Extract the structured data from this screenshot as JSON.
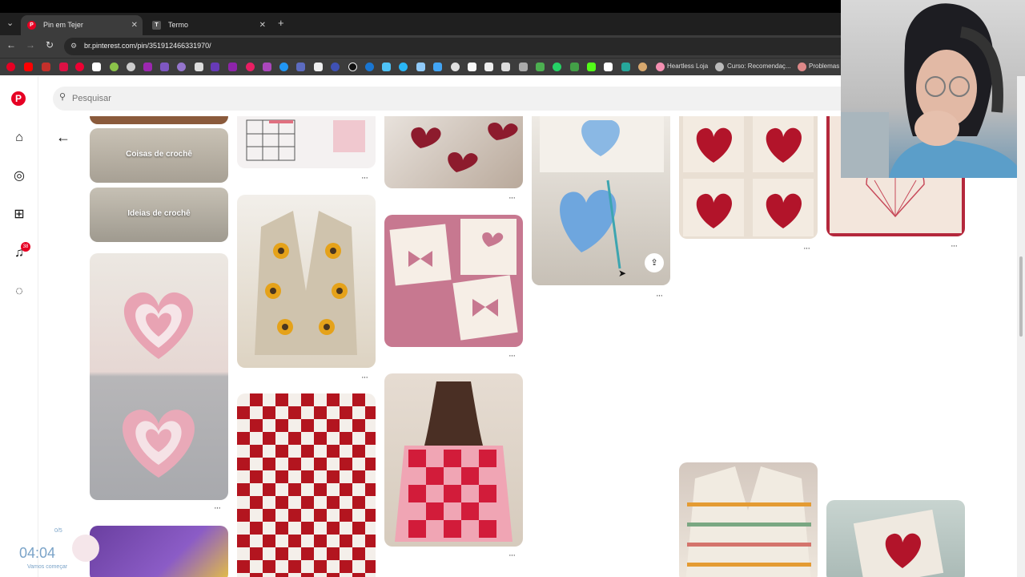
{
  "browser": {
    "tabs": [
      {
        "title": "Pin em Tejer",
        "active": true,
        "favicon_color": "#e60023",
        "favicon_letter": "P"
      },
      {
        "title": "Termo",
        "active": false,
        "favicon_color": "#555555",
        "favicon_letter": "T"
      }
    ],
    "new_tab_symbol": "+",
    "close_symbol": "✕",
    "tab_menu_symbol": "⌄",
    "nav": {
      "back": "←",
      "forward": "→",
      "reload": "↻"
    },
    "url": "br.pinterest.com/pin/351912466331970/",
    "bookmarks": [
      {
        "label": "Heartless Loja"
      },
      {
        "label": "Curso: Recomendaç..."
      },
      {
        "label": "Problemas"
      }
    ]
  },
  "pinterest": {
    "search_placeholder": "Pesquisar",
    "notification_count": "38",
    "back_arrow": "←",
    "pins": [
      {
        "label": "Coisas de crochê"
      },
      {
        "label": "Ideias de crochê"
      }
    ],
    "more_symbol": "···",
    "share_symbol": "⇪"
  },
  "timer": {
    "time": "04:04",
    "counter": "0/5",
    "subtitle": "Vamos começar"
  },
  "colors": {
    "brand": "#e60023",
    "chrome_dark": "#1f1f1f",
    "chrome_mid": "#3c3c3c"
  }
}
